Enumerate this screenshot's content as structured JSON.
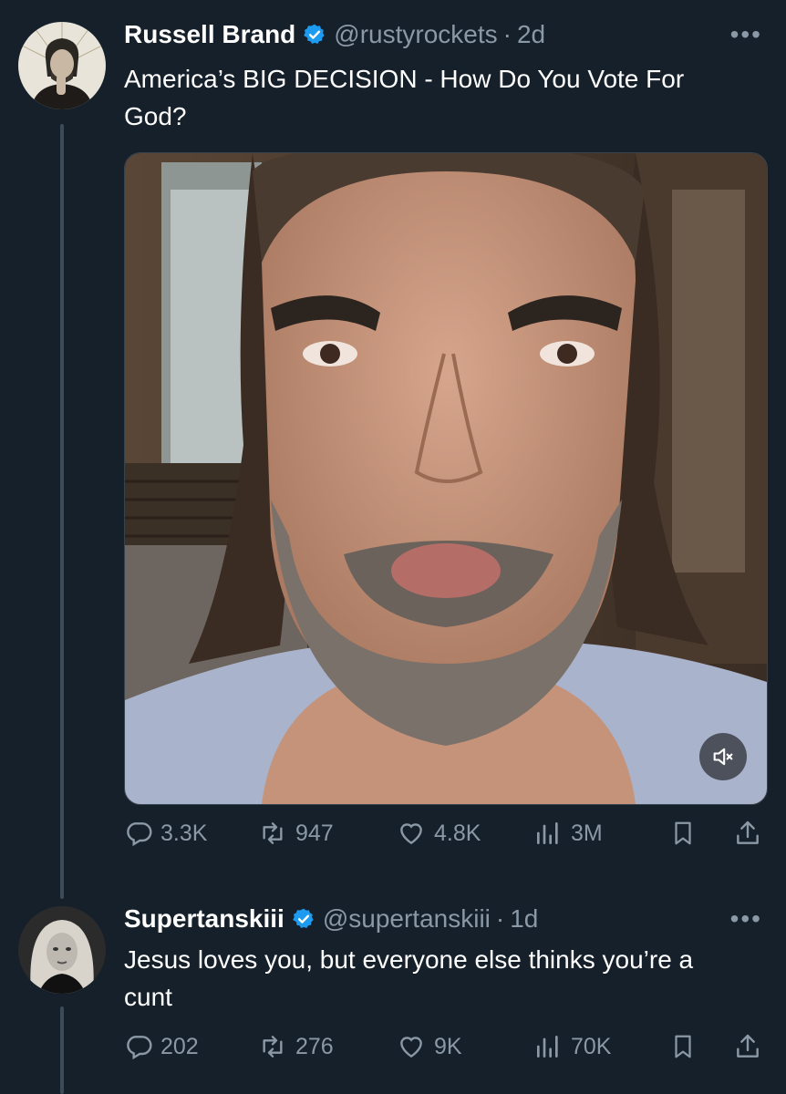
{
  "tweets": [
    {
      "name": "Russell Brand",
      "handle": "@rustyrockets",
      "separator": "·",
      "time": "2d",
      "more": "•••",
      "text": "America’s BIG DECISION - How Do You Vote For God?",
      "has_media": true,
      "stats": {
        "replies": "3.3K",
        "retweets": "947",
        "likes": "4.8K",
        "views": "3M"
      }
    },
    {
      "name": "Supertanskiii",
      "handle": "@supertanskiii",
      "separator": "·",
      "time": "1d",
      "more": "•••",
      "text": "Jesus loves you, but everyone else thinks you’re a cunt",
      "has_media": false,
      "stats": {
        "replies": "202",
        "retweets": "276",
        "likes": "9K",
        "views": "70K"
      }
    }
  ],
  "icons": {
    "verified": "verified-badge-icon",
    "reply": "reply-icon",
    "retweet": "retweet-icon",
    "like": "heart-icon",
    "views": "views-icon",
    "bookmark": "bookmark-icon",
    "share": "share-icon",
    "mute": "mute-icon"
  },
  "colors": {
    "background": "#15202b",
    "text": "#ffffff",
    "muted": "#8b98a5",
    "verified": "#1d9bf0"
  }
}
